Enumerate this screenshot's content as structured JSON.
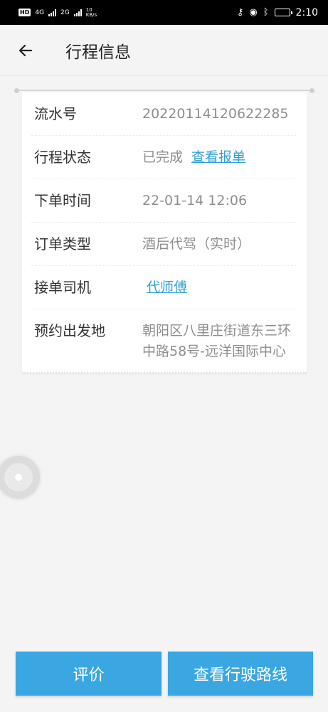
{
  "status_bar": {
    "hd_badge": "HD",
    "network_1": "4G",
    "network_2": "2G",
    "speed_value": "10",
    "speed_unit": "KB/s",
    "time": "2:10"
  },
  "header": {
    "back_icon": "arrow-left-icon",
    "title": "行程信息"
  },
  "trip": {
    "rows": [
      {
        "label": "流水号",
        "value": "20220114120622285"
      },
      {
        "label": "行程状态",
        "value": "已完成",
        "link": "查看报单"
      },
      {
        "label": "下单时间",
        "value": "22-01-14 12:06"
      },
      {
        "label": "订单类型",
        "value": "酒后代驾（实时）"
      },
      {
        "label": "接单司机",
        "link": "代师傅"
      },
      {
        "label": "预约出发地",
        "value": "朝阳区八里庄街道东三环中路58号-远洋国际中心"
      }
    ]
  },
  "buttons": {
    "rate": "评价",
    "view_route": "查看行驶路线"
  },
  "colors": {
    "accent": "#3aa7e3",
    "link": "#2f9fd6",
    "background": "#f4f4f4"
  }
}
